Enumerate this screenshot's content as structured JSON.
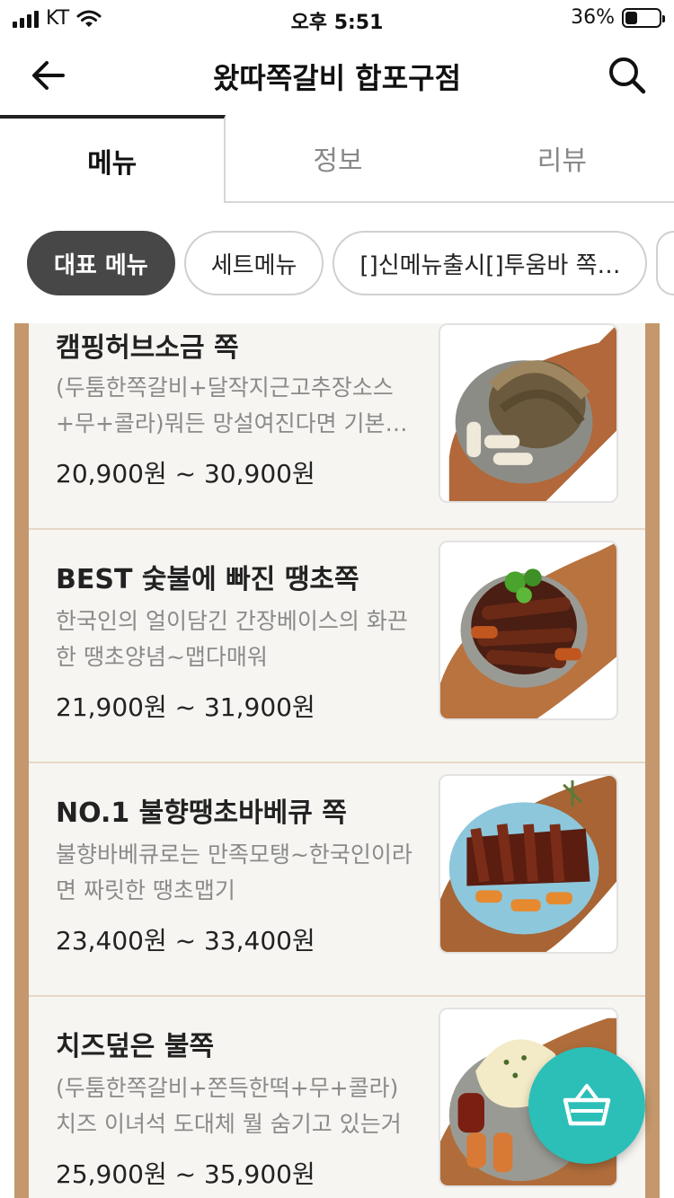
{
  "status_bar": {
    "carrier": "KT",
    "time": "오후 5:51",
    "battery_percent": "36%",
    "battery_level": 0.36
  },
  "header": {
    "title": "왔따쪽갈비 합포구점",
    "back_icon": "arrow-left-icon",
    "search_icon": "search-icon"
  },
  "tabs": [
    {
      "label": "메뉴",
      "active": true
    },
    {
      "label": "정보",
      "active": false
    },
    {
      "label": "리뷰",
      "active": false
    }
  ],
  "categories": [
    {
      "label": "대표 메뉴",
      "active": true
    },
    {
      "label": "세트메뉴",
      "active": false
    },
    {
      "label": "[]신메뉴출시[]투움바 쪽…",
      "active": false
    }
  ],
  "menu_items": [
    {
      "name": "캠핑허브소금 쪽",
      "description": "(두툼한쪽갈비+달작지근고추장소스+무+콜라)뭐든 망설여진다면 기본…",
      "price": "20,900원 ~ 30,900원"
    },
    {
      "name": "BEST 숯불에 빠진 땡초쪽",
      "description": "한국인의 얼이담긴 간장베이스의 화끈한 땡초양념~맵다매워",
      "price": "21,900원 ~ 31,900원"
    },
    {
      "name": "NO.1 불향땡초바베큐 쪽",
      "description": "불향바베큐로는 만족모탱~한국인이라면 짜릿한 땡초맵기",
      "price": "23,400원 ~ 33,400원"
    },
    {
      "name": "치즈덮은 불쪽",
      "description": "(두툼한쪽갈비+쫀득한떡+무+콜라)치즈 이녀석 도대체 뭘 숨기고 있는거야~",
      "price": "25,900원 ~ 35,900원"
    }
  ],
  "cart": {
    "icon": "basket-icon"
  },
  "colors": {
    "accent": "#2bbfb8",
    "chip_active": "#474747",
    "frame_wood": "#c4976c"
  }
}
